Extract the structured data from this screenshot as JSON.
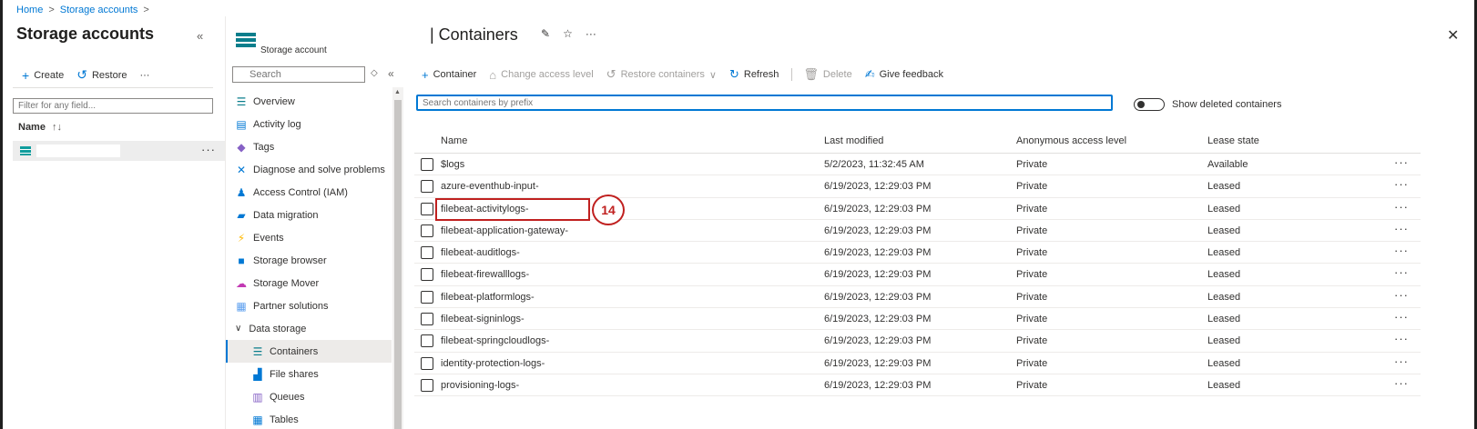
{
  "breadcrumb": {
    "home": "Home",
    "storage_accounts": "Storage accounts",
    "sep": ">"
  },
  "left_blade": {
    "title": "Storage accounts",
    "collapse": "«",
    "create_label": "Create",
    "restore_label": "Restore",
    "more": "···",
    "filter_placeholder": "Filter for any field...",
    "col_name": "Name",
    "sort_icon": "↑↓",
    "row_more": "···"
  },
  "resource_menu": {
    "subtitle": "Storage account",
    "search_placeholder": "Search",
    "items": [
      {
        "label": "Overview",
        "icon": "overview-icon"
      },
      {
        "label": "Activity log",
        "icon": "activity-log-icon"
      },
      {
        "label": "Tags",
        "icon": "tag-icon"
      },
      {
        "label": "Diagnose and solve problems",
        "icon": "wrench-icon"
      },
      {
        "label": "Access Control (IAM)",
        "icon": "iam-icon"
      },
      {
        "label": "Data migration",
        "icon": "data-migration-icon"
      },
      {
        "label": "Events",
        "icon": "lightning-icon"
      },
      {
        "label": "Storage browser",
        "icon": "folder-icon"
      },
      {
        "label": "Storage Mover",
        "icon": "cloud-icon"
      },
      {
        "label": "Partner solutions",
        "icon": "partner-icon"
      },
      {
        "label": "Data storage",
        "icon": "chevron-down-icon"
      },
      {
        "label": "Containers",
        "icon": "containers-icon"
      },
      {
        "label": "File shares",
        "icon": "file-share-icon"
      },
      {
        "label": "Queues",
        "icon": "queue-icon"
      },
      {
        "label": "Tables",
        "icon": "table-icon"
      }
    ]
  },
  "main": {
    "title": "| Containers",
    "toolbar": {
      "container": "Container",
      "change_access": "Change access level",
      "restore_containers": "Restore containers",
      "refresh": "Refresh",
      "delete": "Delete",
      "give_feedback": "Give feedback"
    },
    "search_placeholder": "Search containers by prefix",
    "show_deleted": "Show deleted containers",
    "columns": {
      "name": "Name",
      "last_modified": "Last modified",
      "access": "Anonymous access level",
      "lease": "Lease state"
    },
    "rows": [
      {
        "name": "$logs",
        "modified": "5/2/2023, 11:32:45 AM",
        "access": "Private",
        "lease": "Available"
      },
      {
        "name": "azure-eventhub-input-",
        "modified": "6/19/2023, 12:29:03 PM",
        "access": "Private",
        "lease": "Leased"
      },
      {
        "name": "filebeat-activitylogs-",
        "modified": "6/19/2023, 12:29:03 PM",
        "access": "Private",
        "lease": "Leased"
      },
      {
        "name": "filebeat-application-gateway-",
        "modified": "6/19/2023, 12:29:03 PM",
        "access": "Private",
        "lease": "Leased"
      },
      {
        "name": "filebeat-auditlogs-",
        "modified": "6/19/2023, 12:29:03 PM",
        "access": "Private",
        "lease": "Leased"
      },
      {
        "name": "filebeat-firewalllogs-",
        "modified": "6/19/2023, 12:29:03 PM",
        "access": "Private",
        "lease": "Leased"
      },
      {
        "name": "filebeat-platformlogs-",
        "modified": "6/19/2023, 12:29:03 PM",
        "access": "Private",
        "lease": "Leased"
      },
      {
        "name": "filebeat-signinlogs-",
        "modified": "6/19/2023, 12:29:03 PM",
        "access": "Private",
        "lease": "Leased"
      },
      {
        "name": "filebeat-springcloudlogs-",
        "modified": "6/19/2023, 12:29:03 PM",
        "access": "Private",
        "lease": "Leased"
      },
      {
        "name": "identity-protection-logs-",
        "modified": "6/19/2023, 12:29:03 PM",
        "access": "Private",
        "lease": "Leased"
      },
      {
        "name": "provisioning-logs-",
        "modified": "6/19/2023, 12:29:03 PM",
        "access": "Private",
        "lease": "Leased"
      }
    ],
    "row_more": "···",
    "annotation_number": "14"
  },
  "colors": {
    "accent": "#0078d4",
    "annotation": "#c0201f",
    "selected_bg": "#edebe9"
  }
}
